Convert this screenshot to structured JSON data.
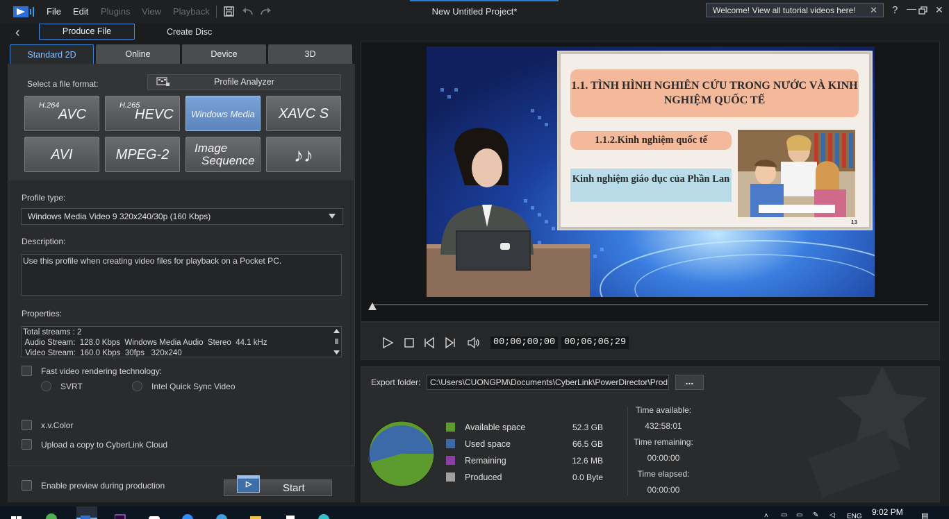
{
  "menu": {
    "file": "File",
    "edit": "Edit",
    "plugins": "Plugins",
    "view": "View",
    "playback": "Playback"
  },
  "window": {
    "title": "New Untitled Project*",
    "welcome": "Welcome! View all tutorial videos here!",
    "help": "?"
  },
  "produce": {
    "produce_file": "Produce File",
    "create_disc": "Create Disc",
    "tabs": [
      "Standard 2D",
      "Online",
      "Device",
      "3D"
    ]
  },
  "formats": {
    "select_label": "Select a file format:",
    "profile_analyzer": "Profile Analyzer",
    "avc_sup": "H.264",
    "avc": "AVC",
    "hevc_sup": "H.265",
    "hevc": "HEVC",
    "windows_media": "Windows Media",
    "xavcs": "XAVC S",
    "avi": "AVI",
    "mpeg2": "MPEG-2",
    "image_seq_1": "Image",
    "image_seq_2": "Sequence",
    "audio": "♪♪"
  },
  "profile": {
    "type_label": "Profile type:",
    "type_value": "Windows Media Video 9 320x240/30p (160 Kbps)",
    "description_label": "Description:",
    "description": "Use this profile when creating video files for playback on a Pocket PC.",
    "properties_label": "Properties:",
    "properties": [
      "Total streams : 2",
      " Audio Stream:  128.0 Kbps  Windows Media Audio  Stereo  44.1 kHz",
      " Video Stream:  160.0 Kbps  30fps   320x240"
    ]
  },
  "options": {
    "fast_render": "Fast video rendering technology:",
    "svrt": "SVRT",
    "quick_sync": "Intel Quick Sync Video",
    "xvcolor": "x.v.Color",
    "cloud": "Upload a copy to CyberLink Cloud",
    "preview_during": "Enable preview during production",
    "start": "Start"
  },
  "slide": {
    "title": "1.1. TÌNH HÌNH NGHIÊN CỨU TRONG NƯỚC VÀ KINH NGHIỆM QUỐC TẾ",
    "subtitle": "1.1.2.Kinh nghiệm quốc tế",
    "box_text": "Kinh nghiệm giáo dục của Phần Lan",
    "page": "13"
  },
  "playback": {
    "current_time": "00;00;00;00",
    "total_time": "00;06;06;29"
  },
  "export": {
    "folder_label": "Export folder:",
    "folder_path": "C:\\Users\\CUONGPM\\Documents\\CyberLink\\PowerDirector\\Prod",
    "browse": "...",
    "legend": [
      {
        "label": "Available space",
        "value": "52.3  GB",
        "color": "#5e9b2e"
      },
      {
        "label": "Used space",
        "value": "66.5  GB",
        "color": "#3c6aa8"
      },
      {
        "label": "Remaining",
        "value": "12.6  MB",
        "color": "#8a3fa8"
      },
      {
        "label": "Produced",
        "value": "0.0  Byte",
        "color": "#a0a0a0"
      }
    ],
    "time_available_label": "Time available:",
    "time_available": "432:58:01",
    "time_remaining_label": "Time remaining:",
    "time_remaining": "00:00:00",
    "time_elapsed_label": "Time elapsed:",
    "time_elapsed": "00:00:00"
  },
  "taskbar": {
    "lang": "ENG",
    "clock": "9:02 PM"
  },
  "colors": {
    "accent": "#3d82d0",
    "active_format": "#6a94cc"
  }
}
